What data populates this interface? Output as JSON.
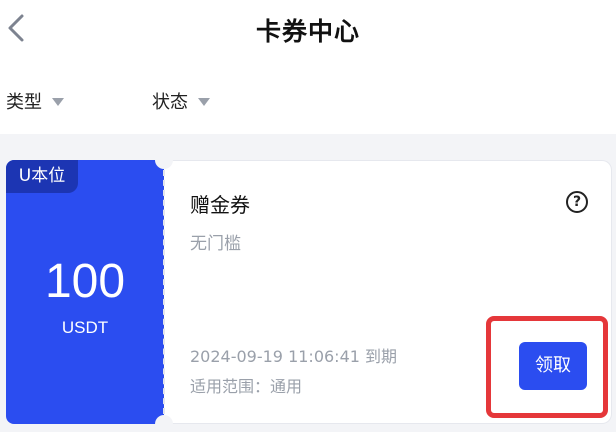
{
  "header": {
    "title": "卡券中心"
  },
  "filters": [
    {
      "label": "类型"
    },
    {
      "label": "状态"
    }
  ],
  "coupon": {
    "tag": "U本位",
    "amount": "100",
    "unit": "USDT",
    "name": "赠金券",
    "threshold": "无门槛",
    "expire": "2024-09-19 11:06:41 到期",
    "scope": "适用范围：通用",
    "claim_label": "领取",
    "help_glyph": "?"
  },
  "colors": {
    "accent": "#2b4df0",
    "tag_dark": "#1c35b3",
    "highlight": "#e5373a"
  }
}
